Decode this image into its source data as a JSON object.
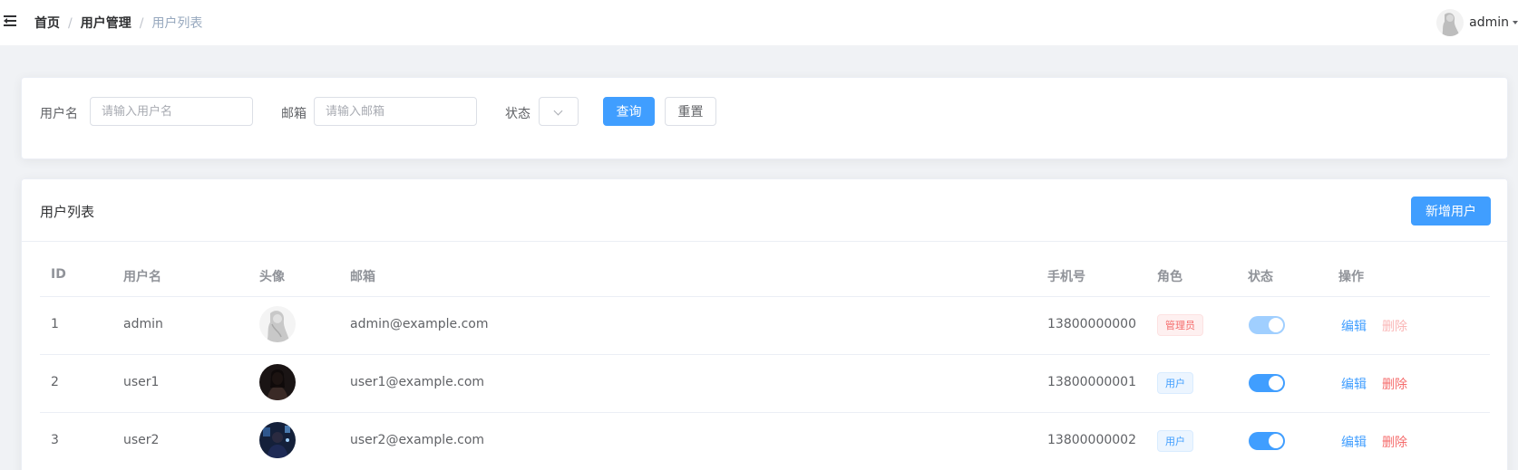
{
  "header": {
    "breadcrumb": [
      "首页",
      "用户管理",
      "用户列表"
    ],
    "separator": "/",
    "username": "admin"
  },
  "search": {
    "username_label": "用户名",
    "username_placeholder": "请输入用户名",
    "email_label": "邮箱",
    "email_placeholder": "请输入邮箱",
    "status_label": "状态",
    "query_button": "查询",
    "reset_button": "重置"
  },
  "table_card": {
    "title": "用户列表",
    "add_button": "新增用户",
    "columns": [
      "ID",
      "用户名",
      "头像",
      "邮箱",
      "手机号",
      "角色",
      "状态",
      "操作"
    ],
    "rows": [
      {
        "id": "1",
        "username": "admin",
        "avatar": "avatar-light",
        "email": "admin@example.com",
        "phone": "13800000000",
        "role": "管理员",
        "role_type": "danger",
        "status": true,
        "status_disabled": true,
        "edit": "编辑",
        "delete": "删除",
        "delete_disabled": true
      },
      {
        "id": "2",
        "username": "user1",
        "avatar": "avatar-dark",
        "email": "user1@example.com",
        "phone": "13800000001",
        "role": "用户",
        "role_type": "info",
        "status": true,
        "status_disabled": false,
        "edit": "编辑",
        "delete": "删除",
        "delete_disabled": false
      },
      {
        "id": "3",
        "username": "user2",
        "avatar": "avatar-blue",
        "email": "user2@example.com",
        "phone": "13800000002",
        "role": "用户",
        "role_type": "info",
        "status": true,
        "status_disabled": false,
        "edit": "编辑",
        "delete": "删除",
        "delete_disabled": false
      }
    ]
  },
  "colors": {
    "primary": "#409eff",
    "danger": "#f56c6c",
    "background": "#f0f2f5"
  }
}
